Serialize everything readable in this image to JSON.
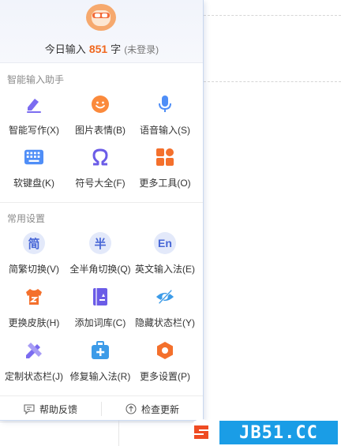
{
  "header": {
    "prefix": "今日输入",
    "count": "851",
    "suffix": "字",
    "status": "(未登录)"
  },
  "sections": {
    "assistant_title": "智能输入助手",
    "settings_title": "常用设置"
  },
  "assistant_items": [
    {
      "label": "智能写作(X)",
      "icon": "pen-icon"
    },
    {
      "label": "图片表情(B)",
      "icon": "smile-icon"
    },
    {
      "label": "语音输入(S)",
      "icon": "microphone-icon"
    },
    {
      "label": "软键盘(K)",
      "icon": "keyboard-icon"
    },
    {
      "label": "符号大全(F)",
      "icon": "omega-icon"
    },
    {
      "label": "更多工具(O)",
      "icon": "grid-tools-icon"
    }
  ],
  "settings_items": [
    {
      "label": "简繁切换(V)",
      "icon": "traditional-simplified-icon",
      "glyph": "简"
    },
    {
      "label": "全半角切换(Q)",
      "icon": "half-width-icon",
      "glyph": "半"
    },
    {
      "label": "英文输入法(E)",
      "icon": "english-input-icon",
      "glyph": "En"
    },
    {
      "label": "更换皮肤(H)",
      "icon": "skin-shirt-icon"
    },
    {
      "label": "添加词库(C)",
      "icon": "dictionary-icon"
    },
    {
      "label": "隐藏状态栏(Y)",
      "icon": "hidden-eye-icon"
    },
    {
      "label": "定制状态栏(J)",
      "icon": "pencil-ruler-icon"
    },
    {
      "label": "修复输入法(R)",
      "icon": "repair-kit-icon"
    },
    {
      "label": "更多设置(P)",
      "icon": "hexagon-settings-icon"
    }
  ],
  "footer": {
    "feedback": "帮助反馈",
    "update": "检查更新"
  },
  "watermark": {
    "text": "JB51.CC"
  },
  "colors": {
    "accent_orange": "#f0681f",
    "accent_blue": "#4766d6",
    "accent_purple": "#7b6cf0",
    "watermark_blue": "#1a9de6"
  }
}
